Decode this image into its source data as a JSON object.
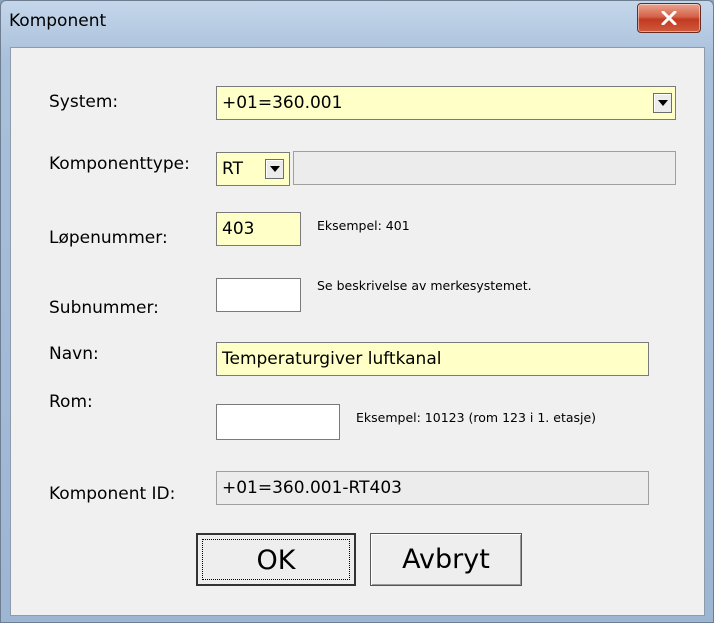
{
  "window": {
    "title": "Komponent"
  },
  "form": {
    "system": {
      "label": "System:",
      "value": "+01=360.001"
    },
    "komponenttype": {
      "label": "Komponenttype:",
      "value": "RT",
      "description": ""
    },
    "lopenummer": {
      "label": "Løpenummer:",
      "value": "403",
      "hint": "Eksempel: 401"
    },
    "subnummer": {
      "label": "Subnummer:",
      "value": "",
      "hint": "Se beskrivelse av merkesystemet."
    },
    "navn": {
      "label": "Navn:",
      "value": "Temperaturgiver luftkanal"
    },
    "rom": {
      "label": "Rom:",
      "value": "",
      "hint": "Eksempel: 10123 (rom 123 i 1. etasje)"
    },
    "komponent_id": {
      "label": "Komponent ID:",
      "value": "+01=360.001-RT403"
    }
  },
  "buttons": {
    "ok": "OK",
    "cancel": "Avbryt"
  },
  "colors": {
    "required_field": "#ffffc8",
    "readonly_field": "#ececec",
    "close_button": "#c9452b"
  }
}
